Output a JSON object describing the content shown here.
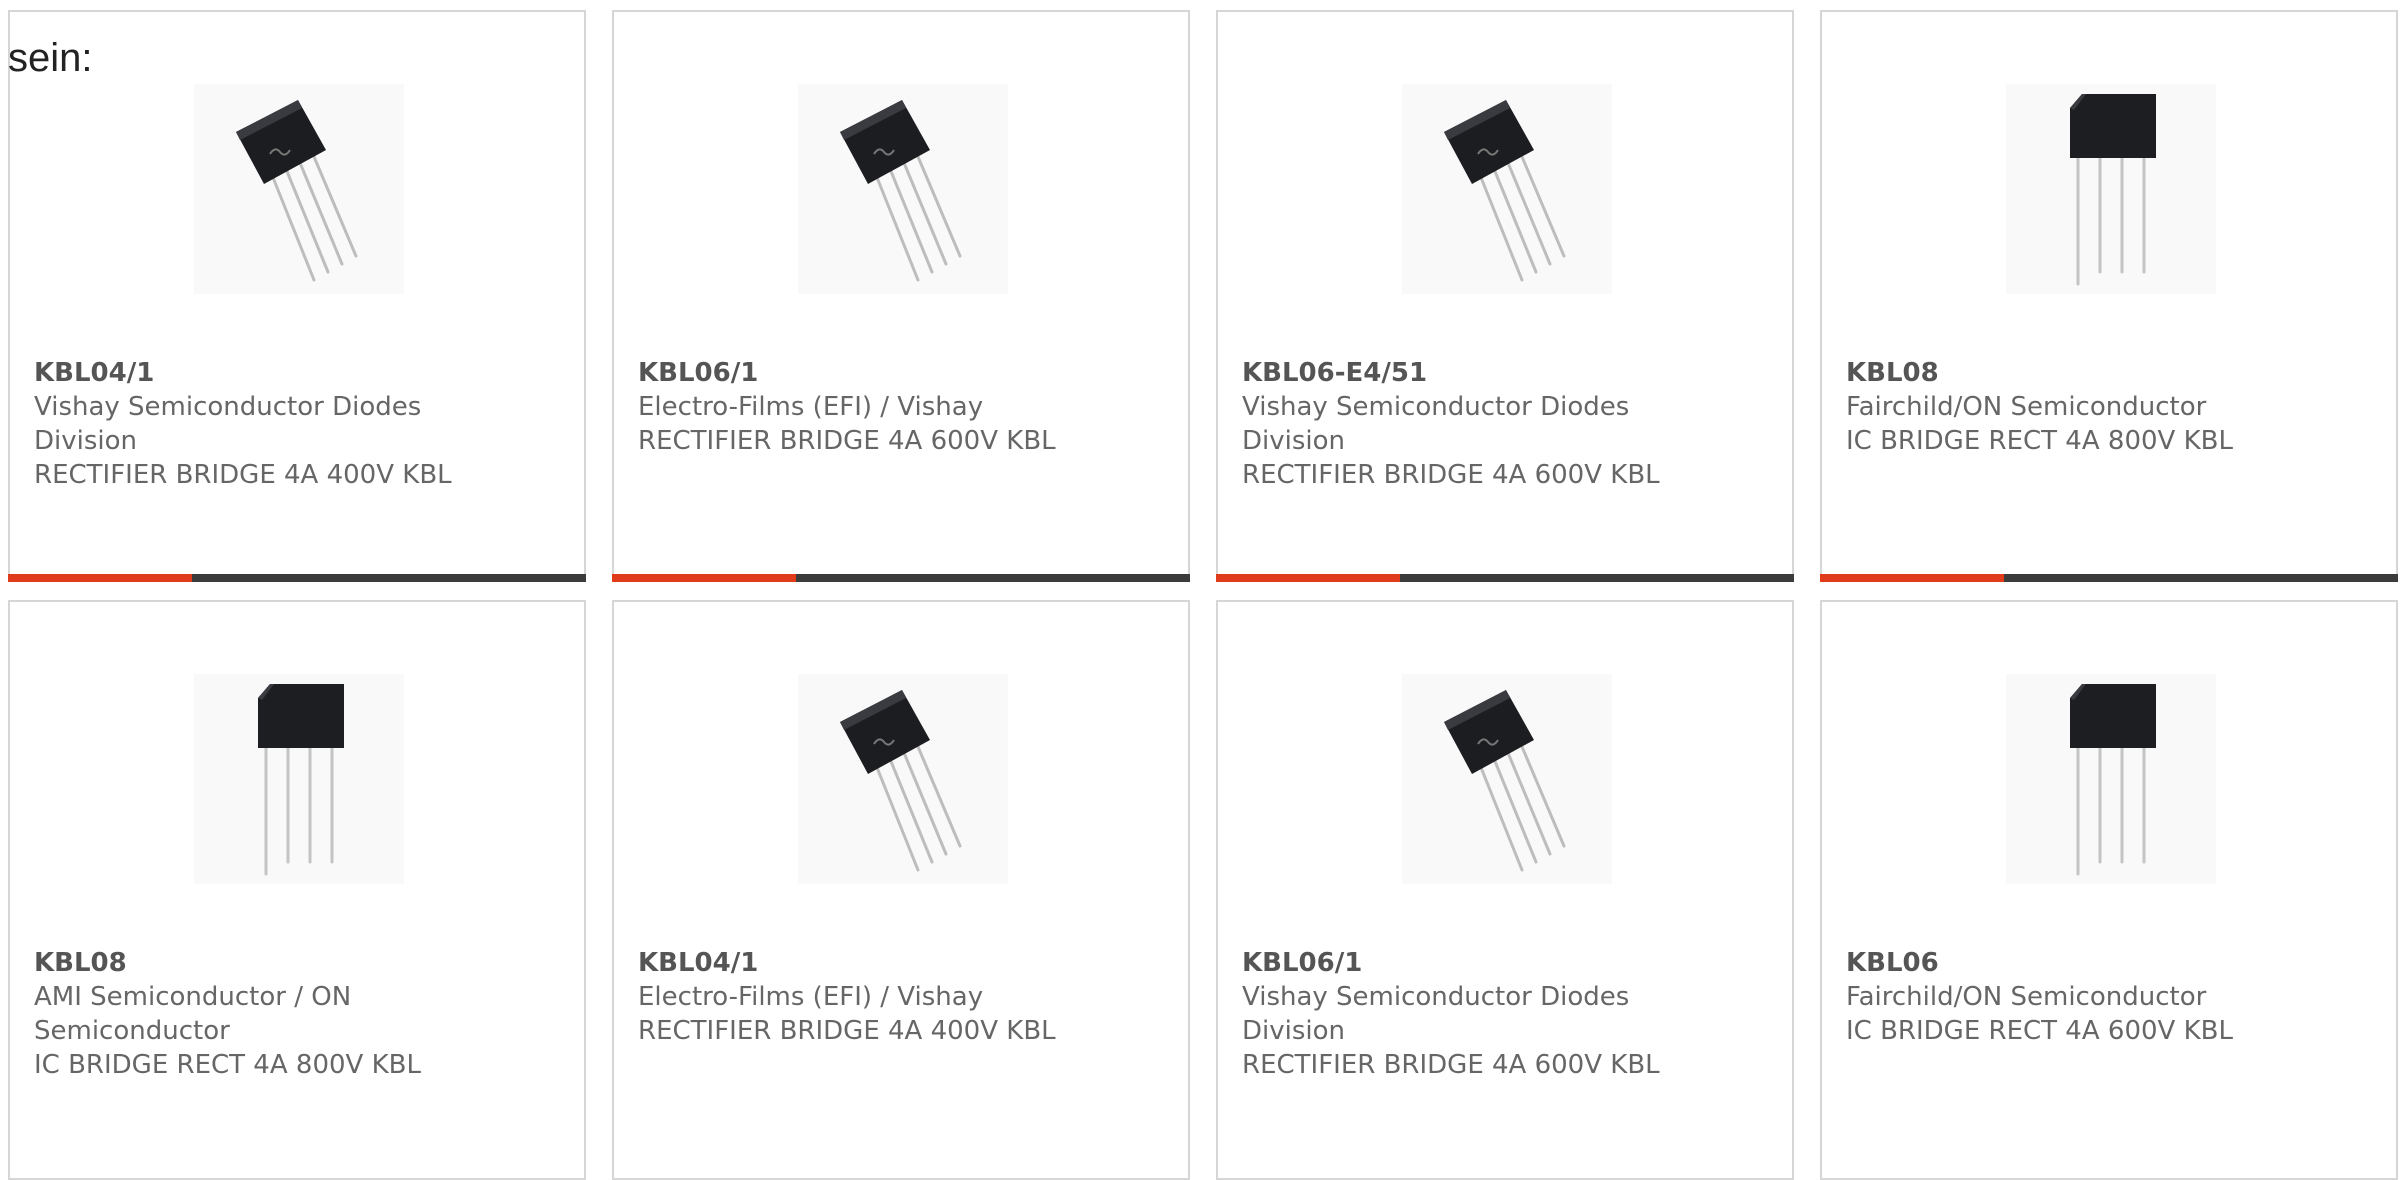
{
  "intro_text": "sein:",
  "accent_color": "#e03c1c",
  "bar_color": "#3b3b3b",
  "cards": [
    {
      "part": "KBL04/1",
      "manufacturer": "Vishay Semiconductor Diodes Division",
      "description": "RECTIFIER BRIDGE 4A 400V KBL",
      "image": "slanted-kbl-package"
    },
    {
      "part": "KBL06/1",
      "manufacturer": "Electro-Films (EFI) / Vishay",
      "description": "RECTIFIER BRIDGE 4A 600V KBL",
      "image": "slanted-kbl-package"
    },
    {
      "part": "KBL06-E4/51",
      "manufacturer": "Vishay Semiconductor Diodes Division",
      "description": "RECTIFIER BRIDGE 4A 600V KBL",
      "image": "slanted-kbl-package"
    },
    {
      "part": "KBL08",
      "manufacturer": "Fairchild/ON Semiconductor",
      "description": "IC BRIDGE RECT 4A 800V KBL",
      "image": "upright-kbl-package"
    },
    {
      "part": "KBL08",
      "manufacturer": "AMI Semiconductor / ON Semiconductor",
      "description": "IC BRIDGE RECT 4A 800V KBL",
      "image": "upright-kbl-package"
    },
    {
      "part": "KBL04/1",
      "manufacturer": "Electro-Films (EFI) / Vishay",
      "description": "RECTIFIER BRIDGE 4A 400V KBL",
      "image": "slanted-kbl-package"
    },
    {
      "part": "KBL06/1",
      "manufacturer": "Vishay Semiconductor Diodes Division",
      "description": "RECTIFIER BRIDGE 4A 600V KBL",
      "image": "slanted-kbl-package"
    },
    {
      "part": "KBL06",
      "manufacturer": "Fairchild/ON Semiconductor",
      "description": "IC BRIDGE RECT 4A 600V KBL",
      "image": "upright-kbl-package"
    }
  ]
}
